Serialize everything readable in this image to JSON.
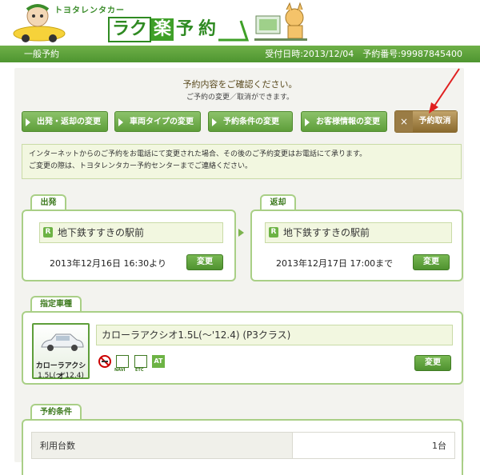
{
  "header": {
    "tagline": "トヨタレンタカー",
    "brand": [
      "ラク",
      "楽",
      "予",
      "約"
    ]
  },
  "statusbar": {
    "left": "一般予約",
    "right": "受付日時:2013/12/04　予約番号:99987845400"
  },
  "main": {
    "title": "予約内容をご確認ください。",
    "subtitle": "ご予約の変更／取消ができます。",
    "nav_buttons": [
      "出発・返却の変更",
      "車両タイプの変更",
      "予約条件の変更",
      "お客様情報の変更"
    ],
    "cancel_label": "予約取消",
    "notice_line1": "インターネットからのご予約をお電話にて変更された場合、その後のご予約変更はお電話にて承ります。",
    "notice_line2": "ご変更の際は、トヨタレンタカー予約センターまでご連絡ください。"
  },
  "departure": {
    "tab": "出発",
    "location": "地下鉄すすきの駅前",
    "datetime": "2013年12月16日 16:30より",
    "change_label": "変更"
  },
  "return": {
    "tab": "返却",
    "location": "地下鉄すすきの駅前",
    "datetime": "2013年12月17日 17:00まで",
    "change_label": "変更"
  },
  "vehicle": {
    "tab": "指定車種",
    "car_name_line1": "カローラアクシオ",
    "car_name_line2": "1.5L(〜'12.4)",
    "description": "カローラアクシオ1.5L(〜'12.4) (P3クラス)",
    "icons": [
      "no-smoking-icon",
      "navi-icon",
      "etc-icon",
      "at-icon"
    ],
    "icon_labels": [
      "NAVI",
      "ETC",
      "AT"
    ],
    "change_label": "変更"
  },
  "conditions": {
    "tab": "予約条件",
    "rows": [
      {
        "label": "利用台数",
        "value": "1台"
      }
    ]
  },
  "colors": {
    "accent_green": "#5e9e3a",
    "cancel_brown": "#8a6a2e",
    "annotation_red": "#e02020"
  }
}
